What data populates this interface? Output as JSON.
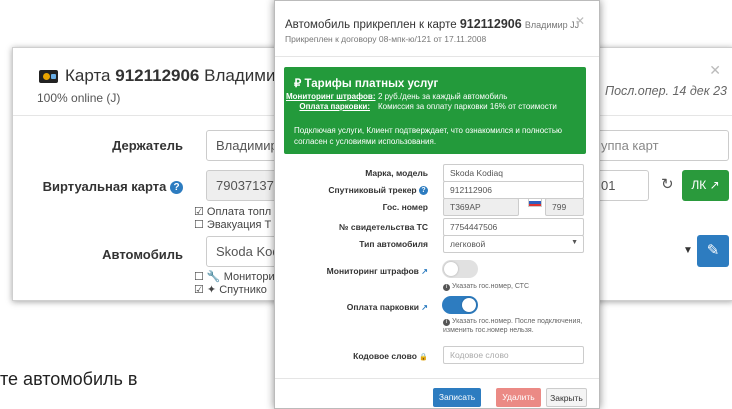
{
  "background": {
    "title_prefix": "Карта",
    "card_number": "912112906",
    "owner": "Владимир JJ",
    "online_status": "100% online (J)",
    "last_operation": "Посл.опер. 14 дек 23",
    "labels": {
      "holder": "Держатель",
      "virtual_card": "Виртуальная карта",
      "vehicle": "Автомобиль"
    },
    "holder_value": "Владимир",
    "group_placeholder": "уппа карт",
    "virtual_card_value": "790371377",
    "virtual_card_suffix": "01",
    "lk_button": "ЛК",
    "checks": [
      "Оплата топл",
      "Эвакуация Т"
    ],
    "vehicle_value": "Skoda Kod",
    "vehicle_checks": [
      "Мониторин",
      "Спутнико"
    ],
    "bottom_text": "те автомобиль в"
  },
  "modal": {
    "title_prefix": "Автомобиль прикреплен к карте",
    "card_number": "912112906",
    "owner": "Владимир JJ",
    "subtitle": "Прикреплен к договору 08-мпк-ю/121 от 17.11.2008",
    "tariff": {
      "title": "Тарифы платных услуг",
      "rows": [
        {
          "label": "Мониторинг штрафов:",
          "value": "2 руб./день за каждый автомобиль"
        },
        {
          "label": "Оплата парковки:",
          "value": "Комиссия за оплату парковки 16% от стоимости"
        }
      ],
      "note": "Подключая услуги, Клиент подтверждает, что ознакомился и полностью согласен с условиями использования."
    },
    "fields": {
      "make_model": {
        "label": "Марка, модель",
        "value": "Skoda Kodiaq"
      },
      "tracker": {
        "label": "Спутниковый трекер",
        "value": "912112906"
      },
      "plate": {
        "label": "Гос. номер",
        "value": "Т369АР",
        "region": "799"
      },
      "certificate": {
        "label": "№ свидетельства ТС",
        "value": "7754447506"
      },
      "vehicle_type": {
        "label": "Тип автомобиля",
        "value": "легковой"
      },
      "fines_monitoring": {
        "label": "Мониторинг штрафов",
        "enabled": false,
        "hint": "Указать гос.номер, СТС"
      },
      "parking_payment": {
        "label": "Оплата парковки",
        "enabled": true,
        "hint_line1": "Указать гос.номер. После подключения,",
        "hint_line2": "изменить гос.номер нельзя."
      },
      "code_word": {
        "label": "Кодовое слово",
        "placeholder": "Кодовое слово"
      }
    },
    "buttons": {
      "save": "Записать",
      "delete": "Удалить",
      "close": "Закрыть"
    }
  },
  "colors": {
    "green": "#239a3b",
    "blue": "#2d7cc0",
    "delete": "#eb8a85"
  }
}
